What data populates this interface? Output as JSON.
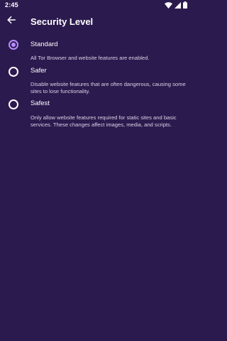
{
  "status_bar": {
    "time": "2:45",
    "icons": [
      "wifi-icon",
      "signal-icon",
      "battery-icon"
    ]
  },
  "app_bar": {
    "back_icon": "arrow-back-icon",
    "title": "Security Level"
  },
  "colors": {
    "background": "#2b1a4e",
    "accent": "#b68dff",
    "text": "#ffffff",
    "secondary_text": "#d9d2e6"
  },
  "options": [
    {
      "title": "Standard",
      "description": "All Tor Browser and website features are enabled.",
      "selected": true
    },
    {
      "title": "Safer",
      "description": "Disable website features that are often dangerous, causing some sites to lose functionality.",
      "selected": false
    },
    {
      "title": "Safest",
      "description": "Only allow website features required for static sites and basic services. These changes affect images, media, and scripts.",
      "selected": false
    }
  ]
}
